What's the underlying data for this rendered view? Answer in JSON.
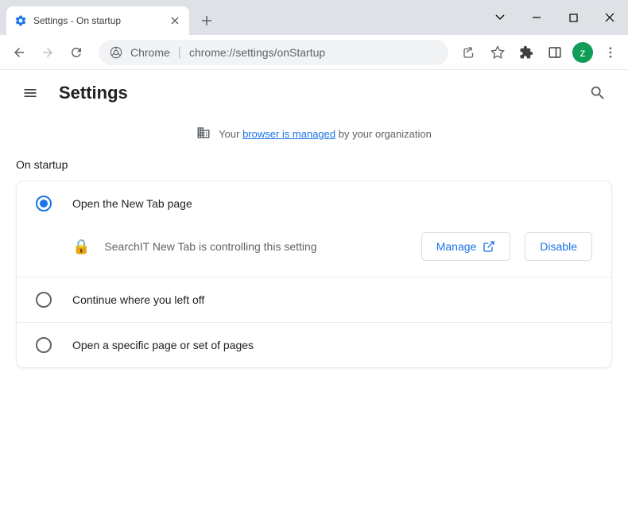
{
  "window": {
    "tab_title": "Settings - On startup"
  },
  "omnibox": {
    "prefix": "Chrome",
    "url_host": "chrome://",
    "url_path": "settings/onStartup"
  },
  "avatar": {
    "letter": "z"
  },
  "header": {
    "title": "Settings"
  },
  "managed": {
    "pre": "Your ",
    "link": "browser is managed",
    "post": " by your organization"
  },
  "section": {
    "title": "On startup"
  },
  "options": [
    {
      "label": "Open the New Tab page",
      "selected": true
    },
    {
      "label": "Continue where you left off",
      "selected": false
    },
    {
      "label": "Open a specific page or set of pages",
      "selected": false
    }
  ],
  "controlled": {
    "text": "SearchIT New Tab is controlling this setting",
    "manage": "Manage",
    "disable": "Disable"
  }
}
